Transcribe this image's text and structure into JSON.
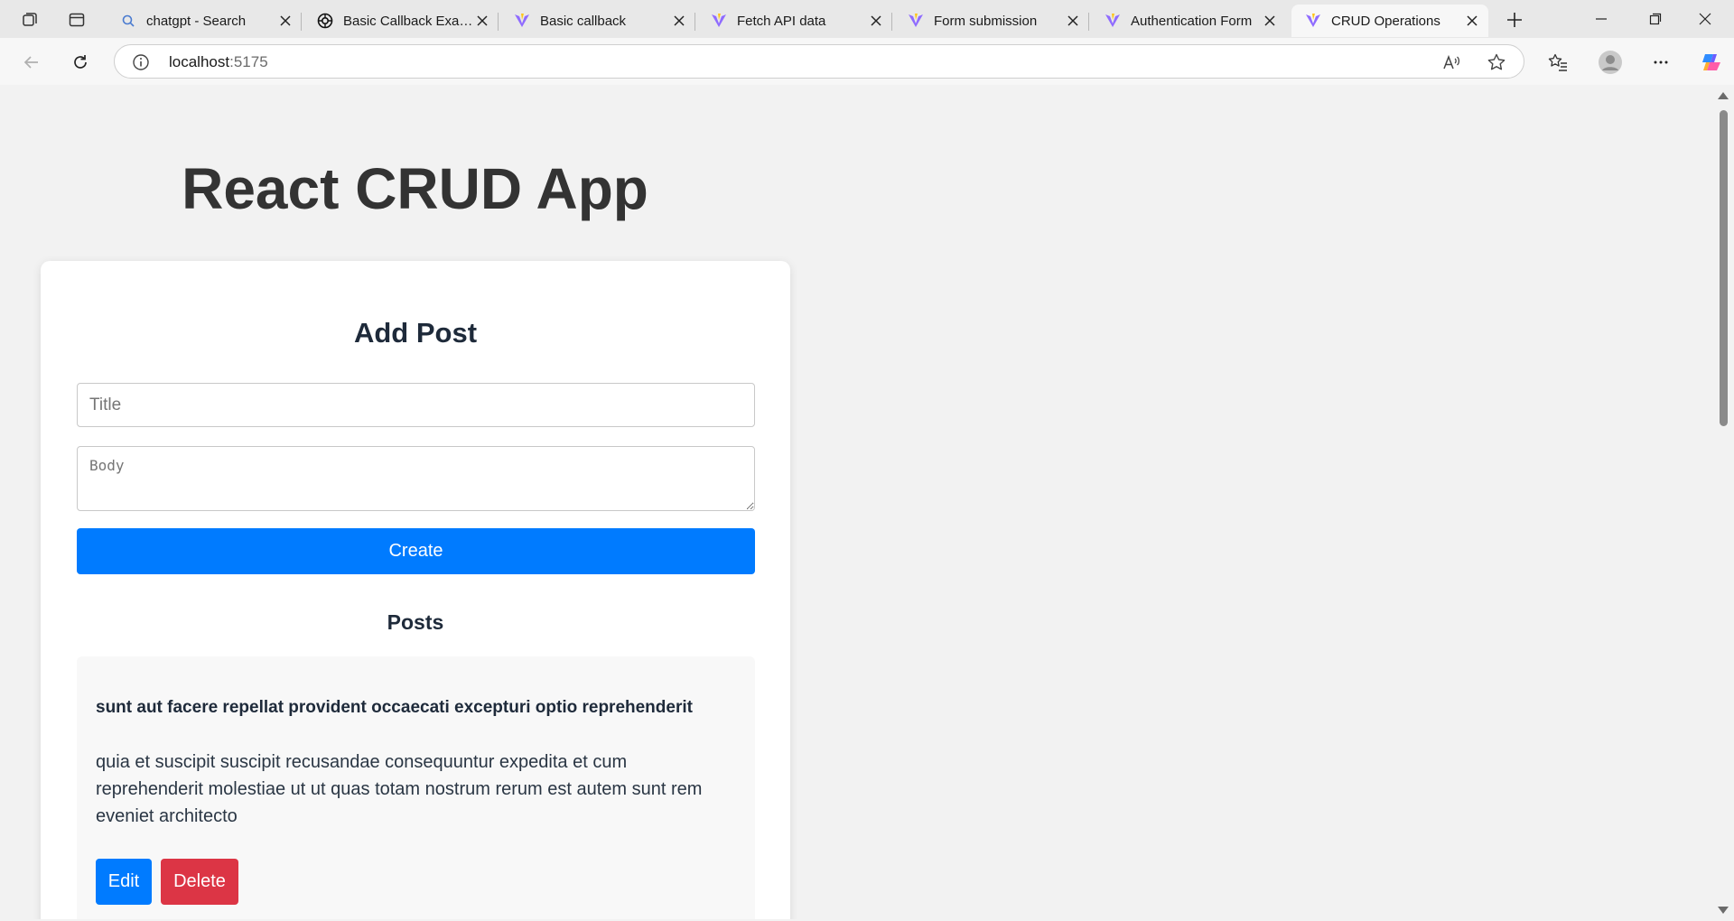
{
  "tabs": [
    {
      "label": "chatgpt - Search",
      "icon": "search-icon",
      "active": false
    },
    {
      "label": "Basic Callback Example",
      "icon": "openai-icon",
      "active": false
    },
    {
      "label": "Basic callback",
      "icon": "vite-icon",
      "active": false
    },
    {
      "label": "Fetch API data",
      "icon": "vite-icon",
      "active": false
    },
    {
      "label": "Form submission",
      "icon": "vite-icon",
      "active": false
    },
    {
      "label": "Authentication Form",
      "icon": "vite-icon",
      "active": false
    },
    {
      "label": "CRUD Operations",
      "icon": "vite-icon",
      "active": true
    }
  ],
  "address_bar": {
    "host": "localhost",
    "port": ":5175"
  },
  "page": {
    "app_title": "React CRUD App",
    "form": {
      "heading": "Add Post",
      "title_placeholder": "Title",
      "body_placeholder": "Body",
      "create_label": "Create"
    },
    "posts_heading": "Posts",
    "posts": [
      {
        "title": "sunt aut facere repellat provident occaecati excepturi optio reprehenderit",
        "body": "quia et suscipit suscipit recusandae consequuntur expedita et cum reprehenderit molestiae ut ut quas totam nostrum rerum est autem sunt rem eveniet architecto",
        "edit_label": "Edit",
        "delete_label": "Delete"
      }
    ]
  },
  "colors": {
    "primary": "#007bff",
    "danger": "#dc3545",
    "page_background": "#f2f2f2",
    "heading_text": "#333333"
  }
}
